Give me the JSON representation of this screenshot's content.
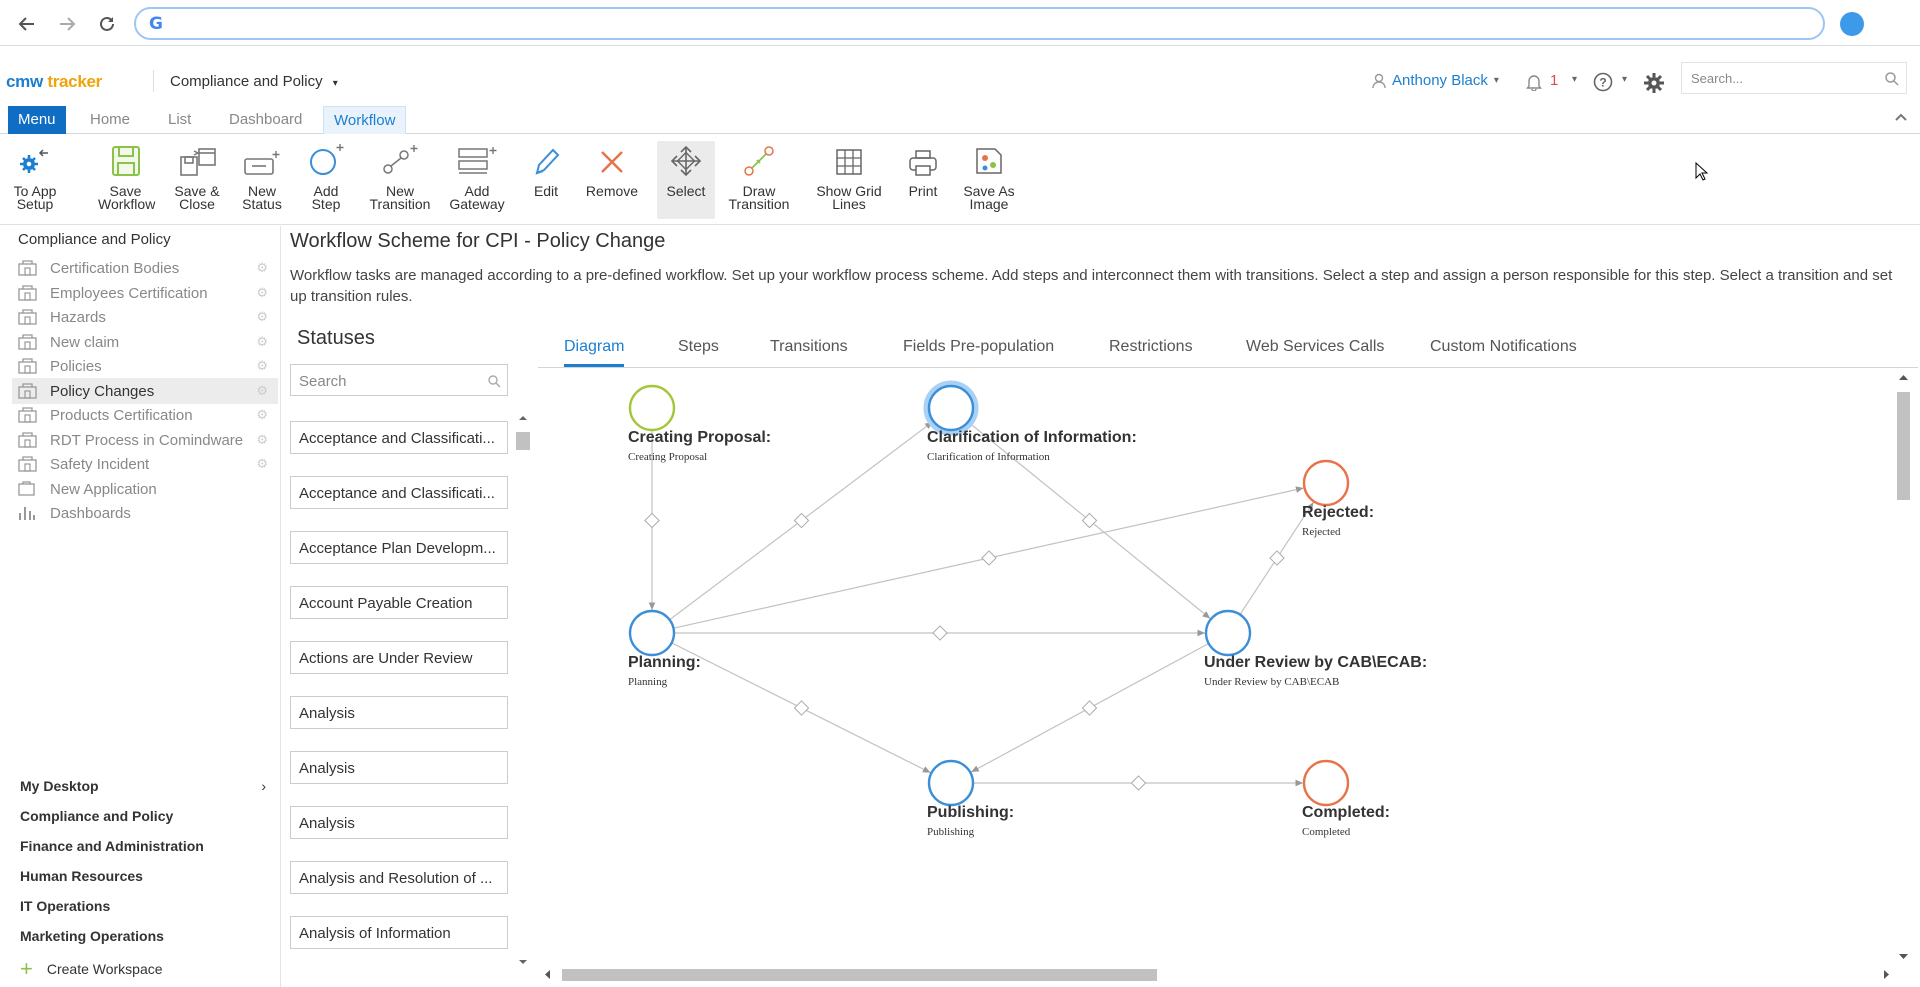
{
  "browser": {
    "address": ""
  },
  "app": {
    "logo_part1": "cmw",
    "logo_part2": "tracker",
    "workspace_title": "Compliance and Policy",
    "user_name": "Anthony Black",
    "notification_count": "1",
    "search_placeholder": "Search..."
  },
  "tabs": [
    "Menu",
    "Home",
    "List",
    "Dashboard",
    "Workflow"
  ],
  "toolbar": [
    {
      "l1": "To App",
      "l2": "Setup",
      "icon": "gear-back-icon"
    },
    {
      "l1": "Save",
      "l2": "Workflow",
      "icon": "save-icon"
    },
    {
      "l1": "Save &",
      "l2": "Close",
      "icon": "save-close-icon"
    },
    {
      "l1": "New",
      "l2": "Status",
      "icon": "new-status-icon"
    },
    {
      "l1": "Add",
      "l2": "Step",
      "icon": "add-step-icon"
    },
    {
      "l1": "New",
      "l2": "Transition",
      "icon": "new-transition-icon"
    },
    {
      "l1": "Add",
      "l2": "Gateway",
      "icon": "add-gateway-icon"
    },
    {
      "l1": "Edit",
      "l2": "",
      "icon": "edit-icon"
    },
    {
      "l1": "Remove",
      "l2": "",
      "icon": "remove-icon"
    },
    {
      "l1": "Select",
      "l2": "",
      "icon": "select-icon"
    },
    {
      "l1": "Draw",
      "l2": "Transition",
      "icon": "draw-transition-icon"
    },
    {
      "l1": "Show Grid",
      "l2": "Lines",
      "icon": "grid-icon"
    },
    {
      "l1": "Print",
      "l2": "",
      "icon": "print-icon"
    },
    {
      "l1": "Save As",
      "l2": "Image",
      "icon": "save-image-icon"
    }
  ],
  "sidebar": {
    "title": "Compliance and Policy",
    "items": [
      "Certification Bodies",
      "Employees Certification",
      "Hazards",
      "New claim",
      "Policies",
      "Policy Changes",
      "Products Certification",
      "RDT Process in Comindware",
      "Safety Incident",
      "New Application",
      "Dashboards"
    ],
    "workspaces": [
      "My Desktop",
      "Compliance and Policy",
      "Finance and Administration",
      "Human Resources",
      "IT Operations",
      "Marketing Operations"
    ],
    "create_workspace": "Create Workspace"
  },
  "page": {
    "title": "Workflow Scheme for CPI - Policy Change",
    "description": "Workflow tasks are managed according to a pre-defined workflow. Set up your workflow process scheme. Add steps and interconnect them with transitions. Select a step and assign a person responsible for this step. Select a transition and set up transition rules."
  },
  "statuses": {
    "title": "Statuses",
    "search_placeholder": "Search",
    "items": [
      "Acceptance and Classificati...",
      "Acceptance and Classificati...",
      "Acceptance Plan Developm...",
      "Account Payable Creation",
      "Actions are Under Review",
      "Analysis",
      "Analysis",
      "Analysis",
      "Analysis and Resolution of ...",
      "Analysis of Information"
    ]
  },
  "diagram_tabs": [
    "Diagram",
    "Steps",
    "Transitions",
    "Fields Pre-population",
    "Restrictions",
    "Web Services Calls",
    "Custom Notifications"
  ],
  "nodes": [
    {
      "label": "Creating Proposal:",
      "sub": "Creating Proposal",
      "color": "#a5c63b"
    },
    {
      "label": "Clarification of Information:",
      "sub": "Clarification of Information",
      "color": "#3b8fd8"
    },
    {
      "label": "Rejected:",
      "sub": "Rejected",
      "color": "#e8734a"
    },
    {
      "label": "Planning:",
      "sub": "Planning",
      "color": "#3b8fd8"
    },
    {
      "label": "Under Review by CAB\\ECAB:",
      "sub": "Under Review by CAB\\ECAB",
      "color": "#3b8fd8"
    },
    {
      "label": "Publishing:",
      "sub": "Publishing",
      "color": "#3b8fd8"
    },
    {
      "label": "Completed:",
      "sub": "Completed",
      "color": "#e8734a"
    }
  ]
}
